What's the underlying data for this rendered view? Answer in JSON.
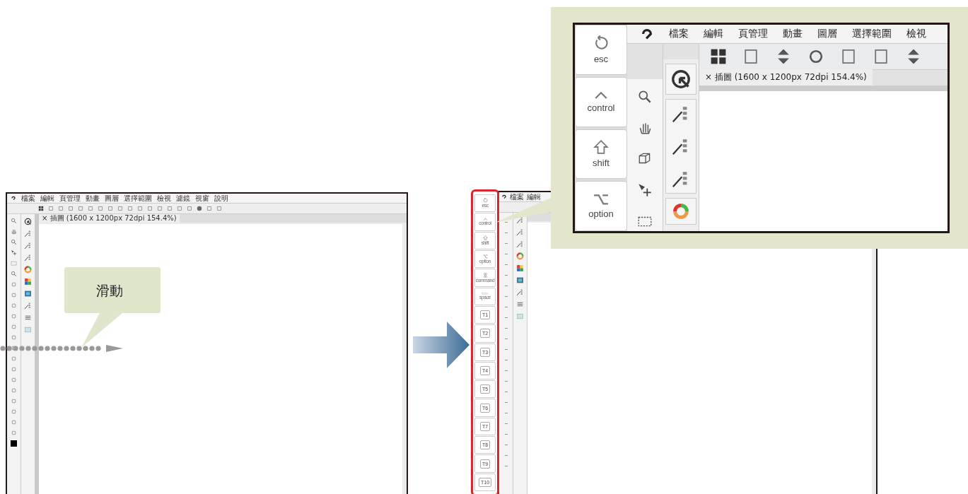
{
  "left_app": {
    "menu": [
      "檔案",
      "編輯",
      "頁管理",
      "動畫",
      "圖層",
      "選擇範圍",
      "檢視",
      "濾鏡",
      "視窗",
      "說明"
    ],
    "document_tab": "× 插圖 (1600 x 1200px 72dpi 154.4%)"
  },
  "callout": {
    "text": "滑動"
  },
  "right_app": {
    "menu": [
      "檔案",
      "編輯"
    ],
    "key_strip": [
      {
        "label": "esc",
        "kind": "esc"
      },
      {
        "label": "control",
        "kind": "control"
      },
      {
        "label": "shift",
        "kind": "shift"
      },
      {
        "label": "option",
        "kind": "option"
      },
      {
        "label": "command",
        "kind": "command"
      },
      {
        "label": "space",
        "kind": "space"
      },
      {
        "label": "T1",
        "kind": "function"
      },
      {
        "label": "T2",
        "kind": "function"
      },
      {
        "label": "T3",
        "kind": "function"
      },
      {
        "label": "T4",
        "kind": "function"
      },
      {
        "label": "T5",
        "kind": "function"
      },
      {
        "label": "T6",
        "kind": "function"
      },
      {
        "label": "T7",
        "kind": "function"
      },
      {
        "label": "T8",
        "kind": "function"
      },
      {
        "label": "T9",
        "kind": "function"
      },
      {
        "label": "T10",
        "kind": "function"
      }
    ]
  },
  "zoom_view": {
    "keys": [
      {
        "label": "esc",
        "kind": "esc"
      },
      {
        "label": "control",
        "kind": "control"
      },
      {
        "label": "shift",
        "kind": "shift"
      },
      {
        "label": "option",
        "kind": "option"
      }
    ],
    "menu": [
      "檔案",
      "編輯",
      "頁管理",
      "動畫",
      "圖層",
      "選擇範圍",
      "檢視"
    ],
    "document_tab": "× 插圖 (1600 x 1200px 72dpi 154.4%)"
  }
}
